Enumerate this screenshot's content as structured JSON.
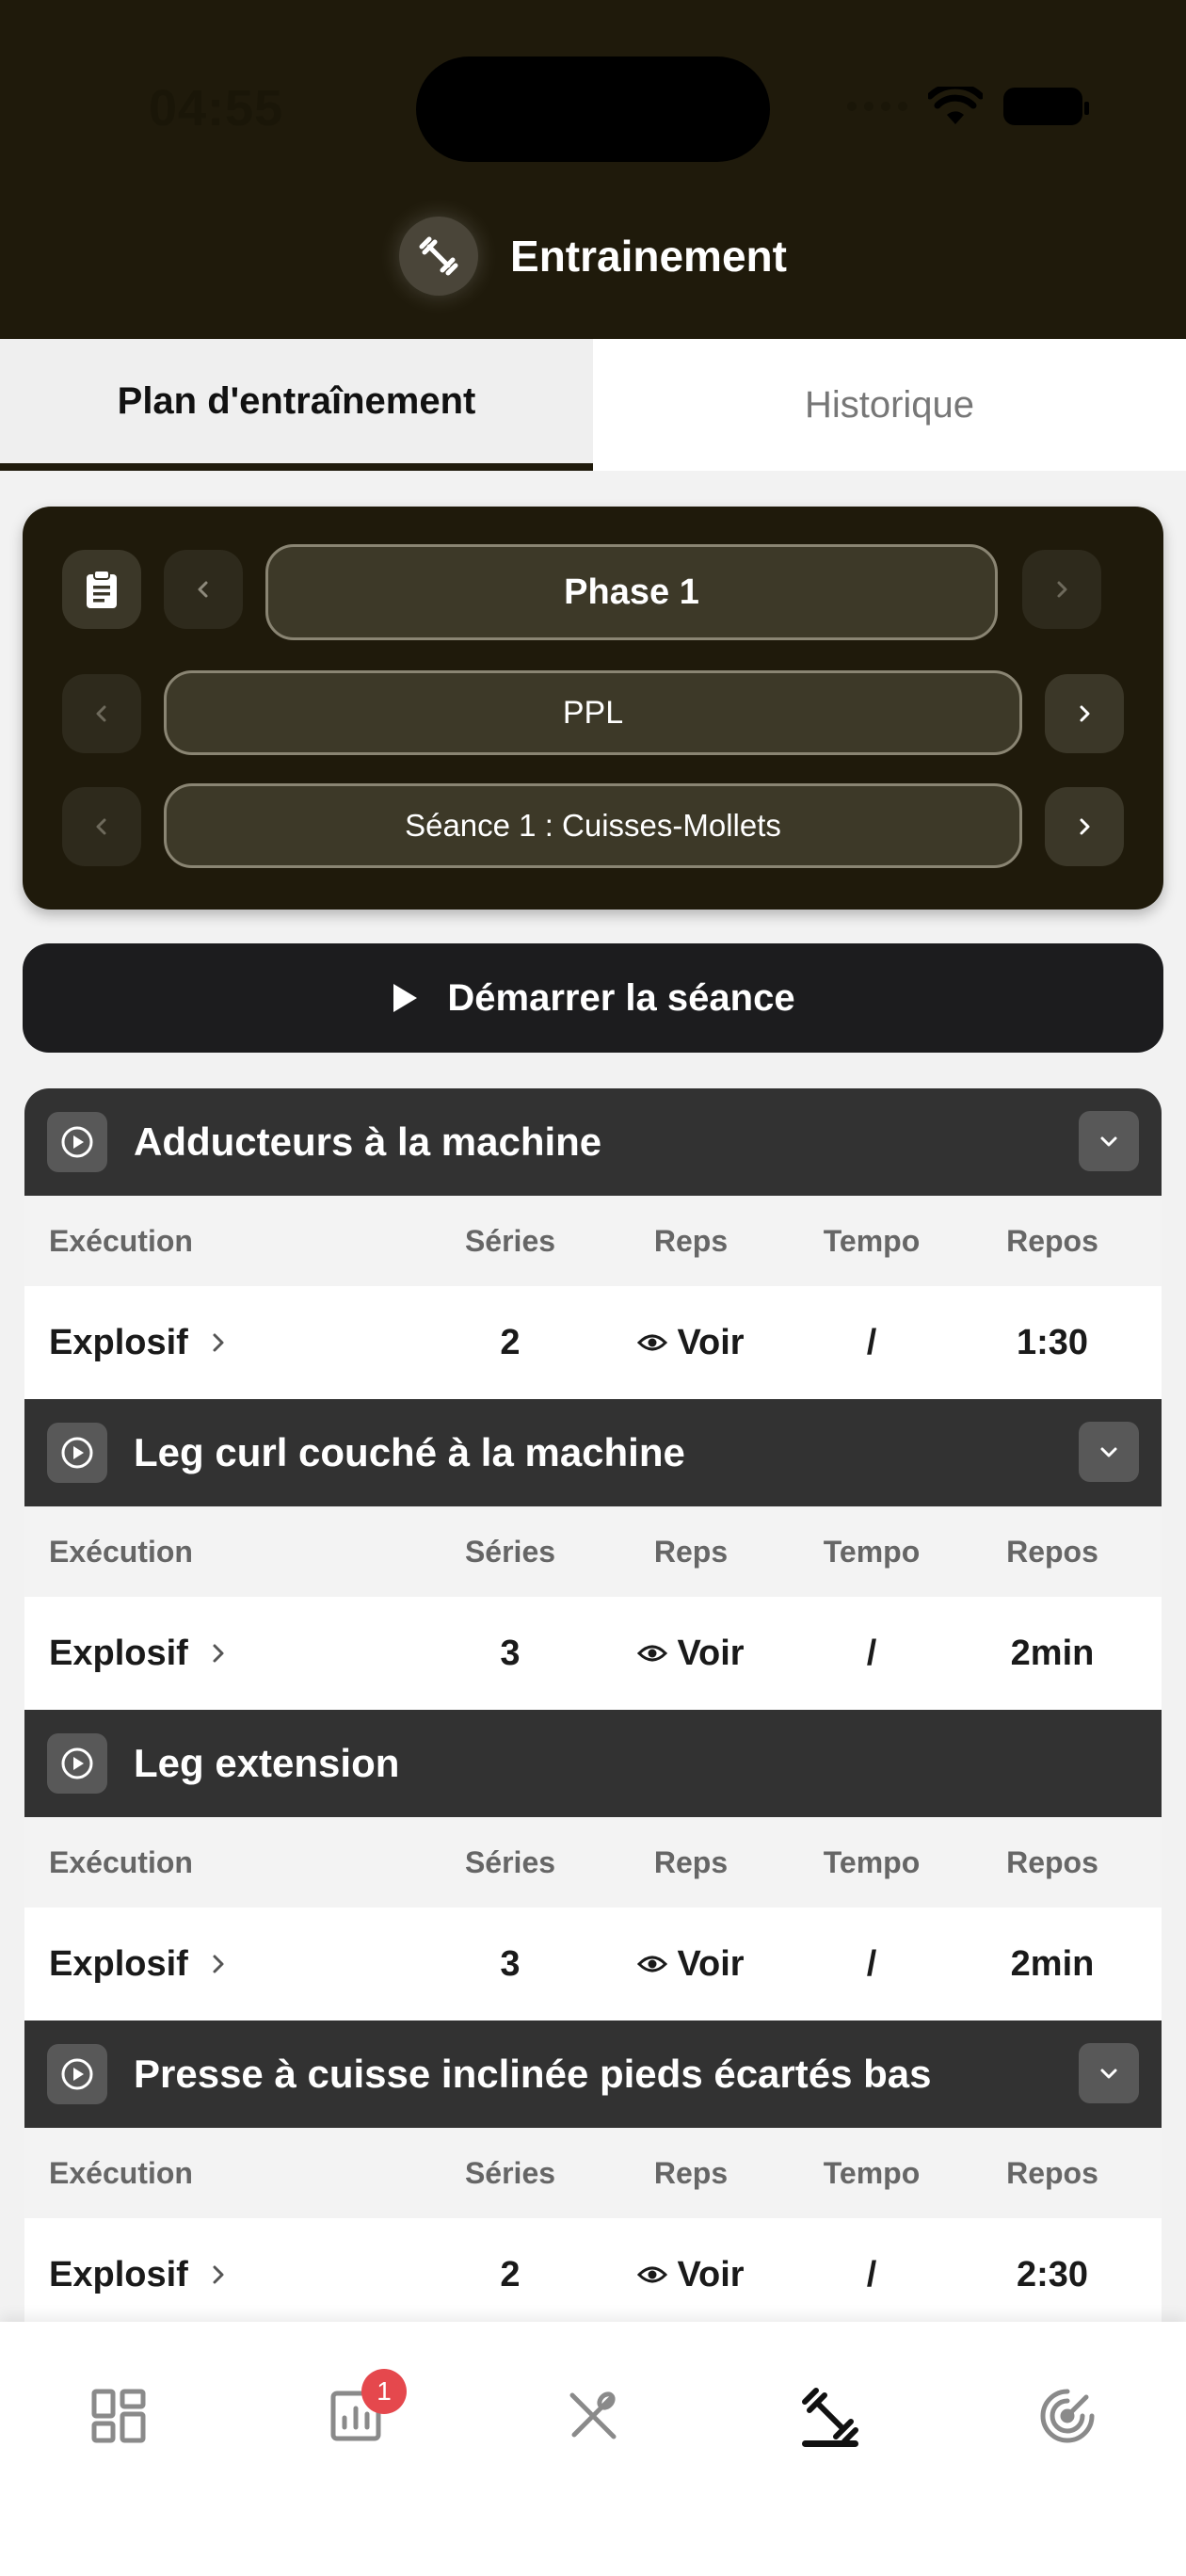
{
  "status_bar": {
    "time": "04:55"
  },
  "header": {
    "title": "Entrainement",
    "icon": "dumbbell-icon"
  },
  "tabs": [
    {
      "label": "Plan d'entraînement",
      "active": true
    },
    {
      "label": "Historique",
      "active": false
    }
  ],
  "selectors": {
    "phase": "Phase 1",
    "program": "PPL",
    "session": "Séance 1 : Cuisses-Mollets"
  },
  "start_button": {
    "label": "Démarrer la séance",
    "icon": "play-icon"
  },
  "columns": {
    "execution": "Exécution",
    "series": "Séries",
    "reps": "Reps",
    "tempo": "Tempo",
    "repos": "Repos"
  },
  "exercises": [
    {
      "name": "Adducteurs à la machine",
      "execution": "Explosif",
      "series": "2",
      "reps": "Voir",
      "tempo": "/",
      "repos": "1:30",
      "has_dropdown": true
    },
    {
      "name": "Leg curl couché à la machine",
      "execution": "Explosif",
      "series": "3",
      "reps": "Voir",
      "tempo": "/",
      "repos": "2min",
      "has_dropdown": true
    },
    {
      "name": "Leg extension",
      "execution": "Explosif",
      "series": "3",
      "reps": "Voir",
      "tempo": "/",
      "repos": "2min",
      "has_dropdown": false
    },
    {
      "name": "Presse à cuisse inclinée pieds écartés bas",
      "execution": "Explosif",
      "series": "2",
      "reps": "Voir",
      "tempo": "/",
      "repos": "2:30",
      "has_dropdown": true
    }
  ],
  "bottom_nav": {
    "items": [
      "dashboard-icon",
      "stats-icon",
      "nutrition-icon",
      "training-icon",
      "goals-icon"
    ],
    "active": "training-icon",
    "stats_badge": "1"
  },
  "colors": {
    "header_bg": "#1f1a0b",
    "selector_bg": "#1f1a0b",
    "exercise_header_bg": "#323232",
    "badge": "#e5484d"
  }
}
